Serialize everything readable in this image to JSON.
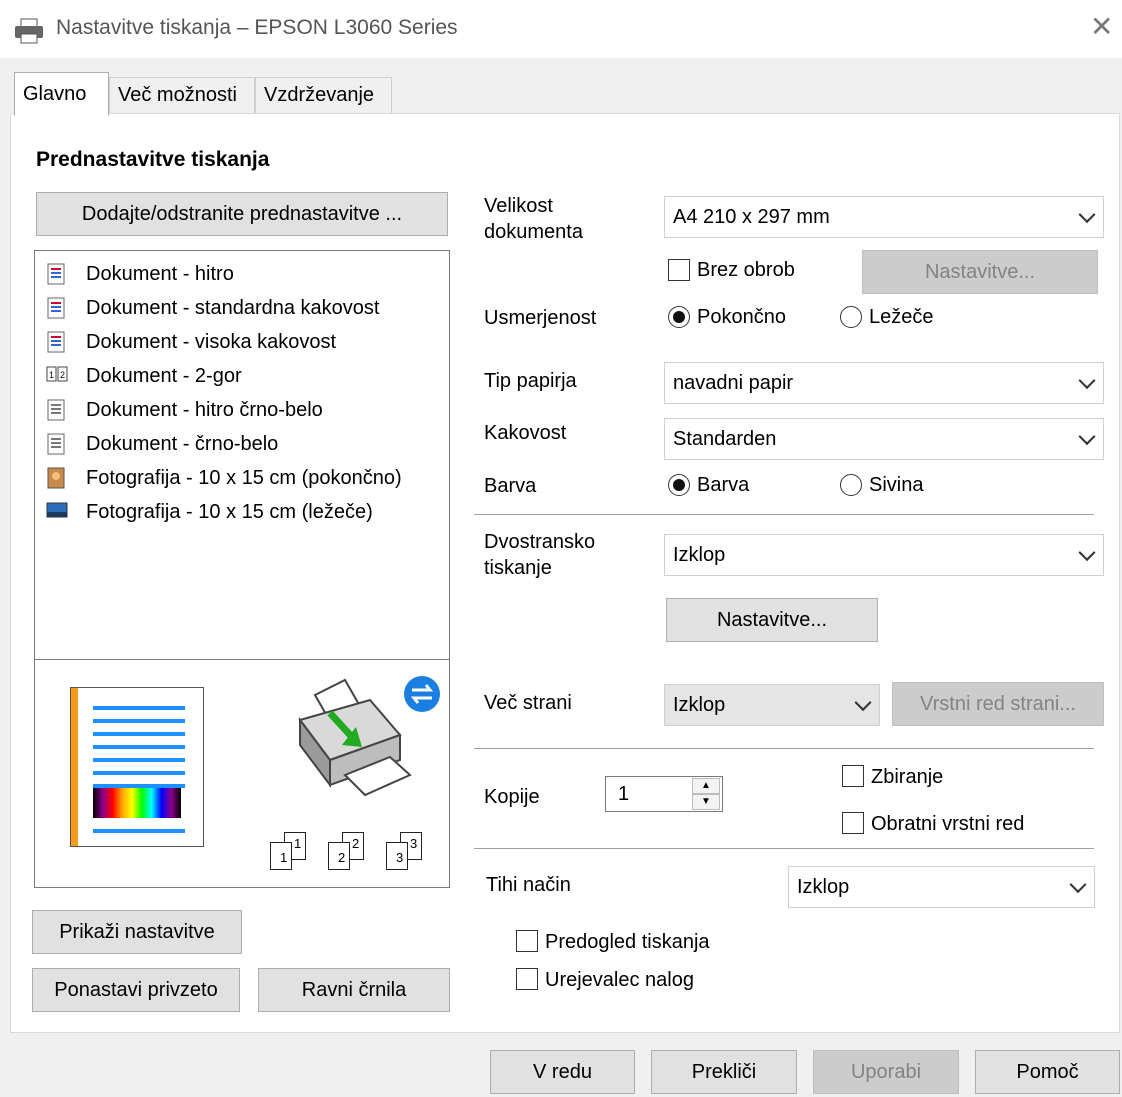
{
  "window": {
    "title": "Nastavitve tiskanja – EPSON L3060 Series"
  },
  "tabs": [
    "Glavno",
    "Več možnosti",
    "Vzdrževanje"
  ],
  "presets": {
    "heading": "Prednastavitve tiskanja",
    "add_button": "Dodajte/odstranite prednastavitve ...",
    "items": [
      "Dokument - hitro",
      "Dokument - standardna kakovost",
      "Dokument - visoka kakovost",
      "Dokument - 2-gor",
      "Dokument - hitro črno-belo",
      "Dokument - črno-belo",
      "Fotografija - 10 x 15 cm (pokončno)",
      "Fotografija - 10 x 15 cm (ležeče)"
    ],
    "item_icons": [
      "doc-icon",
      "doc-icon",
      "doc-icon",
      "two-up-icon",
      "doc-bw-icon",
      "doc-bw-icon",
      "photo-portrait-icon",
      "photo-landscape-icon"
    ],
    "collate_badges": [
      {
        "back": "1",
        "front": "1"
      },
      {
        "back": "2",
        "front": "2"
      },
      {
        "back": "3",
        "front": "3"
      }
    ]
  },
  "left_buttons": {
    "show_settings": "Prikaži nastavitve",
    "reset": "Ponastavi privzeto",
    "ink_levels": "Ravni črnila"
  },
  "settings": {
    "doc_size_label": "Velikost dokumenta",
    "doc_size_value": "A4 210 x 297 mm",
    "borderless_label": "Brez obrob",
    "borderless_checked": false,
    "borderless_settings": "Nastavitve...",
    "orientation_label": "Usmerjenost",
    "orientation_portrait": "Pokončno",
    "orientation_landscape": "Ležeče",
    "orientation_selected": "Pokončno",
    "paper_type_label": "Tip papirja",
    "paper_type_value": "navadni papir",
    "quality_label": "Kakovost",
    "quality_value": "Standarden",
    "color_label": "Barva",
    "color_option_color": "Barva",
    "color_option_gray": "Sivina",
    "color_selected": "Barva",
    "duplex_label": "Dvostransko tiskanje",
    "duplex_value": "Izklop",
    "duplex_settings": "Nastavitve...",
    "multipage_label": "Več strani",
    "multipage_value": "Izklop",
    "page_order": "Vrstni red strani...",
    "copies_label": "Kopije",
    "copies_value": "1",
    "collate_label": "Zbiranje",
    "collate_checked": false,
    "reverse_label": "Obratni vrstni red",
    "reverse_checked": false,
    "quiet_label": "Tihi način",
    "quiet_value": "Izklop",
    "preview_label": "Predogled tiskanja",
    "preview_checked": false,
    "job_arranger_label": "Urejevalec nalog",
    "job_arranger_checked": false
  },
  "footer": {
    "ok": "V redu",
    "cancel": "Prekliči",
    "apply": "Uporabi",
    "help": "Pomoč"
  }
}
